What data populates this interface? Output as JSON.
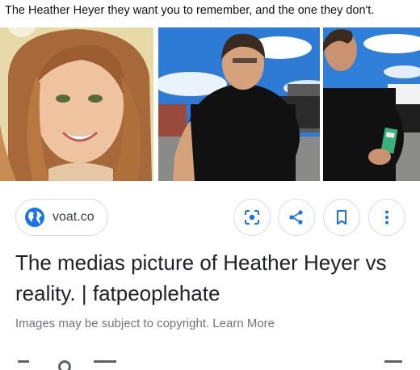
{
  "image_viewer": {
    "caption": "The Heather Heyer they want you to remember, and the one they don't."
  },
  "source": {
    "site": "voat.co"
  },
  "result": {
    "title": "The medias picture of Heather Heyer vs reality. | fatpeoplehate",
    "copyright_note": "Images may be subject to copyright.",
    "learn_more": "Learn More"
  },
  "colors": {
    "accent_blue": "#1a73e8",
    "border": "#dadce0",
    "muted_text": "#70757a"
  },
  "icons": [
    "close-icon",
    "globe-icon",
    "lens-icon",
    "share-icon",
    "bookmark-icon",
    "more-vert-icon"
  ]
}
